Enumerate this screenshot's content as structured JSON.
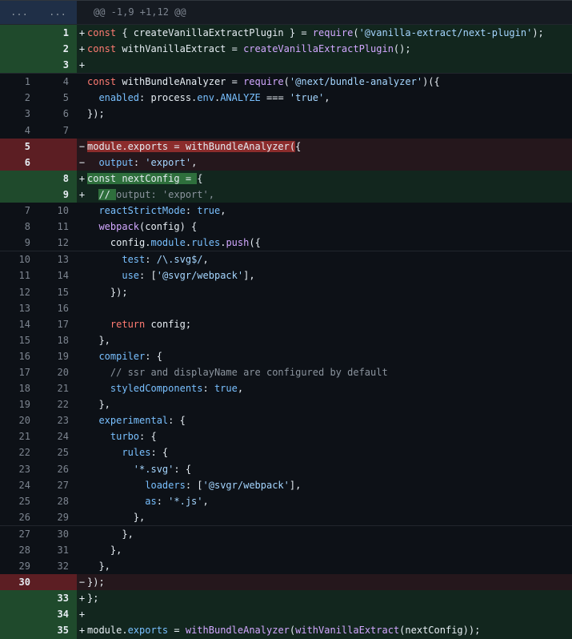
{
  "hunk": {
    "old": "...",
    "new": "...",
    "text": "@@ -1,9 +1,12 @@"
  },
  "colors": {
    "add_bg": "#12261e",
    "del_bg": "#25171c",
    "add_gutter": "#1f4a2c",
    "del_gutter": "#5c1e23"
  },
  "lines": [
    {
      "type": "add",
      "old": "",
      "new": "1",
      "marker": "+",
      "tokens": [
        [
          "kw",
          "const"
        ],
        [
          "plain",
          " { createVanillaExtractPlugin } = "
        ],
        [
          "fn",
          "require"
        ],
        [
          "plain",
          "("
        ],
        [
          "str",
          "'@vanilla-extract/next-plugin'"
        ],
        [
          "plain",
          ");"
        ]
      ]
    },
    {
      "type": "add",
      "old": "",
      "new": "2",
      "marker": "+",
      "tokens": [
        [
          "kw",
          "const"
        ],
        [
          "plain",
          " withVanillaExtract = "
        ],
        [
          "fn",
          "createVanillaExtractPlugin"
        ],
        [
          "plain",
          "();"
        ]
      ]
    },
    {
      "type": "add",
      "old": "",
      "new": "3",
      "marker": "+",
      "tokens": []
    },
    {
      "type": "ctx",
      "old": "1",
      "new": "4",
      "marker": "",
      "sep": true,
      "tokens": [
        [
          "kw",
          "const"
        ],
        [
          "plain",
          " withBundleAnalyzer = "
        ],
        [
          "fn",
          "require"
        ],
        [
          "plain",
          "("
        ],
        [
          "str",
          "'@next/bundle-analyzer'"
        ],
        [
          "plain",
          ")({"
        ]
      ]
    },
    {
      "type": "ctx",
      "old": "2",
      "new": "5",
      "marker": "",
      "tokens": [
        [
          "plain",
          "  "
        ],
        [
          "prop",
          "enabled"
        ],
        [
          "plain",
          ": process."
        ],
        [
          "prop",
          "env"
        ],
        [
          "plain",
          "."
        ],
        [
          "prop",
          "ANALYZE"
        ],
        [
          "plain",
          " === "
        ],
        [
          "str",
          "'true'"
        ],
        [
          "plain",
          ","
        ]
      ]
    },
    {
      "type": "ctx",
      "old": "3",
      "new": "6",
      "marker": "",
      "tokens": [
        [
          "plain",
          "});"
        ]
      ]
    },
    {
      "type": "ctx",
      "old": "4",
      "new": "7",
      "marker": "",
      "tokens": []
    },
    {
      "type": "del",
      "old": "5",
      "new": "",
      "marker": "−",
      "tokens": [
        [
          "hl-del",
          "module.exports = withBundleAnalyzer("
        ],
        [
          "plain",
          "{"
        ]
      ]
    },
    {
      "type": "del",
      "old": "6",
      "new": "",
      "marker": "−",
      "tokens": [
        [
          "plain",
          "  "
        ],
        [
          "prop",
          "output"
        ],
        [
          "plain",
          ": "
        ],
        [
          "str",
          "'export'"
        ],
        [
          "plain",
          ","
        ]
      ]
    },
    {
      "type": "add",
      "old": "",
      "new": "8",
      "marker": "+",
      "tokens": [
        [
          "hl-add",
          "const nextConfig = "
        ],
        [
          "plain",
          "{"
        ]
      ]
    },
    {
      "type": "add",
      "old": "",
      "new": "9",
      "marker": "+",
      "tokens": [
        [
          "plain",
          "  "
        ],
        [
          "hl-add",
          "// "
        ],
        [
          "com",
          "output: 'export',"
        ]
      ]
    },
    {
      "type": "ctx",
      "old": "7",
      "new": "10",
      "marker": "",
      "tokens": [
        [
          "plain",
          "  "
        ],
        [
          "prop",
          "reactStrictMode"
        ],
        [
          "plain",
          ": "
        ],
        [
          "prop",
          "true"
        ],
        [
          "plain",
          ","
        ]
      ]
    },
    {
      "type": "ctx",
      "old": "8",
      "new": "11",
      "marker": "",
      "tokens": [
        [
          "plain",
          "  "
        ],
        [
          "fn",
          "webpack"
        ],
        [
          "plain",
          "(config) {"
        ]
      ]
    },
    {
      "type": "ctx",
      "old": "9",
      "new": "12",
      "marker": "",
      "tokens": [
        [
          "plain",
          "    config."
        ],
        [
          "prop",
          "module"
        ],
        [
          "plain",
          "."
        ],
        [
          "prop",
          "rules"
        ],
        [
          "plain",
          "."
        ],
        [
          "fn",
          "push"
        ],
        [
          "plain",
          "({"
        ]
      ]
    },
    {
      "type": "ctx",
      "old": "10",
      "new": "13",
      "marker": "",
      "sep": true,
      "tokens": [
        [
          "plain",
          "      "
        ],
        [
          "prop",
          "test"
        ],
        [
          "plain",
          ": "
        ],
        [
          "str",
          "/\\.svg$/"
        ],
        [
          "plain",
          ","
        ]
      ]
    },
    {
      "type": "ctx",
      "old": "11",
      "new": "14",
      "marker": "",
      "tokens": [
        [
          "plain",
          "      "
        ],
        [
          "prop",
          "use"
        ],
        [
          "plain",
          ": ["
        ],
        [
          "str",
          "'@svgr/webpack'"
        ],
        [
          "plain",
          "],"
        ]
      ]
    },
    {
      "type": "ctx",
      "old": "12",
      "new": "15",
      "marker": "",
      "tokens": [
        [
          "plain",
          "    });"
        ]
      ]
    },
    {
      "type": "ctx",
      "old": "13",
      "new": "16",
      "marker": "",
      "tokens": []
    },
    {
      "type": "ctx",
      "old": "14",
      "new": "17",
      "marker": "",
      "tokens": [
        [
          "plain",
          "    "
        ],
        [
          "kw",
          "return"
        ],
        [
          "plain",
          " config;"
        ]
      ]
    },
    {
      "type": "ctx",
      "old": "15",
      "new": "18",
      "marker": "",
      "tokens": [
        [
          "plain",
          "  },"
        ]
      ]
    },
    {
      "type": "ctx",
      "old": "16",
      "new": "19",
      "marker": "",
      "tokens": [
        [
          "plain",
          "  "
        ],
        [
          "prop",
          "compiler"
        ],
        [
          "plain",
          ": {"
        ]
      ]
    },
    {
      "type": "ctx",
      "old": "17",
      "new": "20",
      "marker": "",
      "tokens": [
        [
          "plain",
          "    "
        ],
        [
          "com",
          "// ssr and displayName are configured by default"
        ]
      ]
    },
    {
      "type": "ctx",
      "old": "18",
      "new": "21",
      "marker": "",
      "tokens": [
        [
          "plain",
          "    "
        ],
        [
          "prop",
          "styledComponents"
        ],
        [
          "plain",
          ": "
        ],
        [
          "prop",
          "true"
        ],
        [
          "plain",
          ","
        ]
      ]
    },
    {
      "type": "ctx",
      "old": "19",
      "new": "22",
      "marker": "",
      "tokens": [
        [
          "plain",
          "  },"
        ]
      ]
    },
    {
      "type": "ctx",
      "old": "20",
      "new": "23",
      "marker": "",
      "tokens": [
        [
          "plain",
          "  "
        ],
        [
          "prop",
          "experimental"
        ],
        [
          "plain",
          ": {"
        ]
      ]
    },
    {
      "type": "ctx",
      "old": "21",
      "new": "24",
      "marker": "",
      "tokens": [
        [
          "plain",
          "    "
        ],
        [
          "prop",
          "turbo"
        ],
        [
          "plain",
          ": {"
        ]
      ]
    },
    {
      "type": "ctx",
      "old": "22",
      "new": "25",
      "marker": "",
      "tokens": [
        [
          "plain",
          "      "
        ],
        [
          "prop",
          "rules"
        ],
        [
          "plain",
          ": {"
        ]
      ]
    },
    {
      "type": "ctx",
      "old": "23",
      "new": "26",
      "marker": "",
      "tokens": [
        [
          "plain",
          "        "
        ],
        [
          "str",
          "'*.svg'"
        ],
        [
          "plain",
          ": {"
        ]
      ]
    },
    {
      "type": "ctx",
      "old": "24",
      "new": "27",
      "marker": "",
      "tokens": [
        [
          "plain",
          "          "
        ],
        [
          "prop",
          "loaders"
        ],
        [
          "plain",
          ": ["
        ],
        [
          "str",
          "'@svgr/webpack'"
        ],
        [
          "plain",
          "],"
        ]
      ]
    },
    {
      "type": "ctx",
      "old": "25",
      "new": "28",
      "marker": "",
      "tokens": [
        [
          "plain",
          "          "
        ],
        [
          "prop",
          "as"
        ],
        [
          "plain",
          ": "
        ],
        [
          "str",
          "'*.js'"
        ],
        [
          "plain",
          ","
        ]
      ]
    },
    {
      "type": "ctx",
      "old": "26",
      "new": "29",
      "marker": "",
      "tokens": [
        [
          "plain",
          "        },"
        ]
      ]
    },
    {
      "type": "ctx",
      "old": "27",
      "new": "30",
      "marker": "",
      "sep": true,
      "tokens": [
        [
          "plain",
          "      },"
        ]
      ]
    },
    {
      "type": "ctx",
      "old": "28",
      "new": "31",
      "marker": "",
      "tokens": [
        [
          "plain",
          "    },"
        ]
      ]
    },
    {
      "type": "ctx",
      "old": "29",
      "new": "32",
      "marker": "",
      "tokens": [
        [
          "plain",
          "  },"
        ]
      ]
    },
    {
      "type": "del",
      "old": "30",
      "new": "",
      "marker": "−",
      "tokens": [
        [
          "plain",
          "});"
        ]
      ]
    },
    {
      "type": "add",
      "old": "",
      "new": "33",
      "marker": "+",
      "tokens": [
        [
          "plain",
          "};"
        ]
      ]
    },
    {
      "type": "add",
      "old": "",
      "new": "34",
      "marker": "+",
      "tokens": []
    },
    {
      "type": "add",
      "old": "",
      "new": "35",
      "marker": "+",
      "tokens": [
        [
          "plain",
          "module."
        ],
        [
          "prop",
          "exports"
        ],
        [
          "plain",
          " = "
        ],
        [
          "fn",
          "withBundleAnalyzer"
        ],
        [
          "plain",
          "("
        ],
        [
          "fn",
          "withVanillaExtract"
        ],
        [
          "plain",
          "(nextConfig));"
        ]
      ]
    }
  ]
}
